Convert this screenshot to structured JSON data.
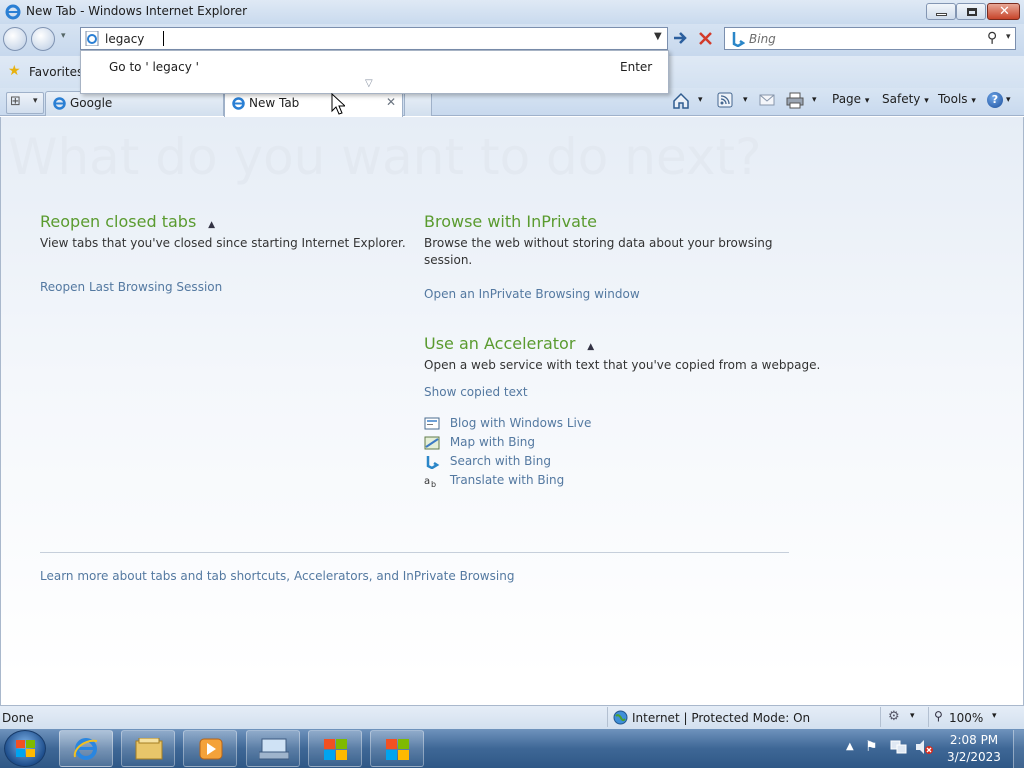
{
  "window": {
    "title": "New Tab - Windows Internet Explorer"
  },
  "address": {
    "value": "legacy"
  },
  "suggestion": {
    "goto_prefix": "Go to '",
    "query": "legacy",
    "goto_suffix": "'",
    "enter": "Enter"
  },
  "search": {
    "placeholder": "Bing"
  },
  "favorites": {
    "label": "Favorites"
  },
  "tabs": [
    {
      "label": "Google"
    },
    {
      "label": "New Tab"
    }
  ],
  "command_bar": {
    "page": "Page",
    "safety": "Safety",
    "tools": "Tools"
  },
  "page": {
    "heading": "What do you want to do next?",
    "reopen": {
      "title": "Reopen closed tabs",
      "desc": "View tabs that you've closed since starting Internet Explorer.",
      "link": "Reopen Last Browsing Session"
    },
    "inprivate": {
      "title": "Browse with InPrivate",
      "desc_line1": "Browse the web without storing data about your browsing",
      "desc_line2": "session.",
      "link": "Open an InPrivate Browsing window"
    },
    "accelerator": {
      "title": "Use an Accelerator",
      "desc": "Open a web service with text that you've copied from a webpage.",
      "show": "Show copied text",
      "items": [
        {
          "label": "Blog with Windows Live",
          "icon": "blog-icon"
        },
        {
          "label": "Map with Bing",
          "icon": "map-icon"
        },
        {
          "label": "Search with Bing",
          "icon": "bing-icon"
        },
        {
          "label": "Translate with Bing",
          "icon": "translate-icon"
        }
      ]
    },
    "footer_link": "Learn more about tabs and tab shortcuts, Accelerators, and InPrivate Browsing"
  },
  "status": {
    "left": "Done",
    "zone": "Internet | Protected Mode: On",
    "zoom": "100%"
  },
  "clock": {
    "time": "2:08 PM",
    "date": "3/2/2023"
  }
}
